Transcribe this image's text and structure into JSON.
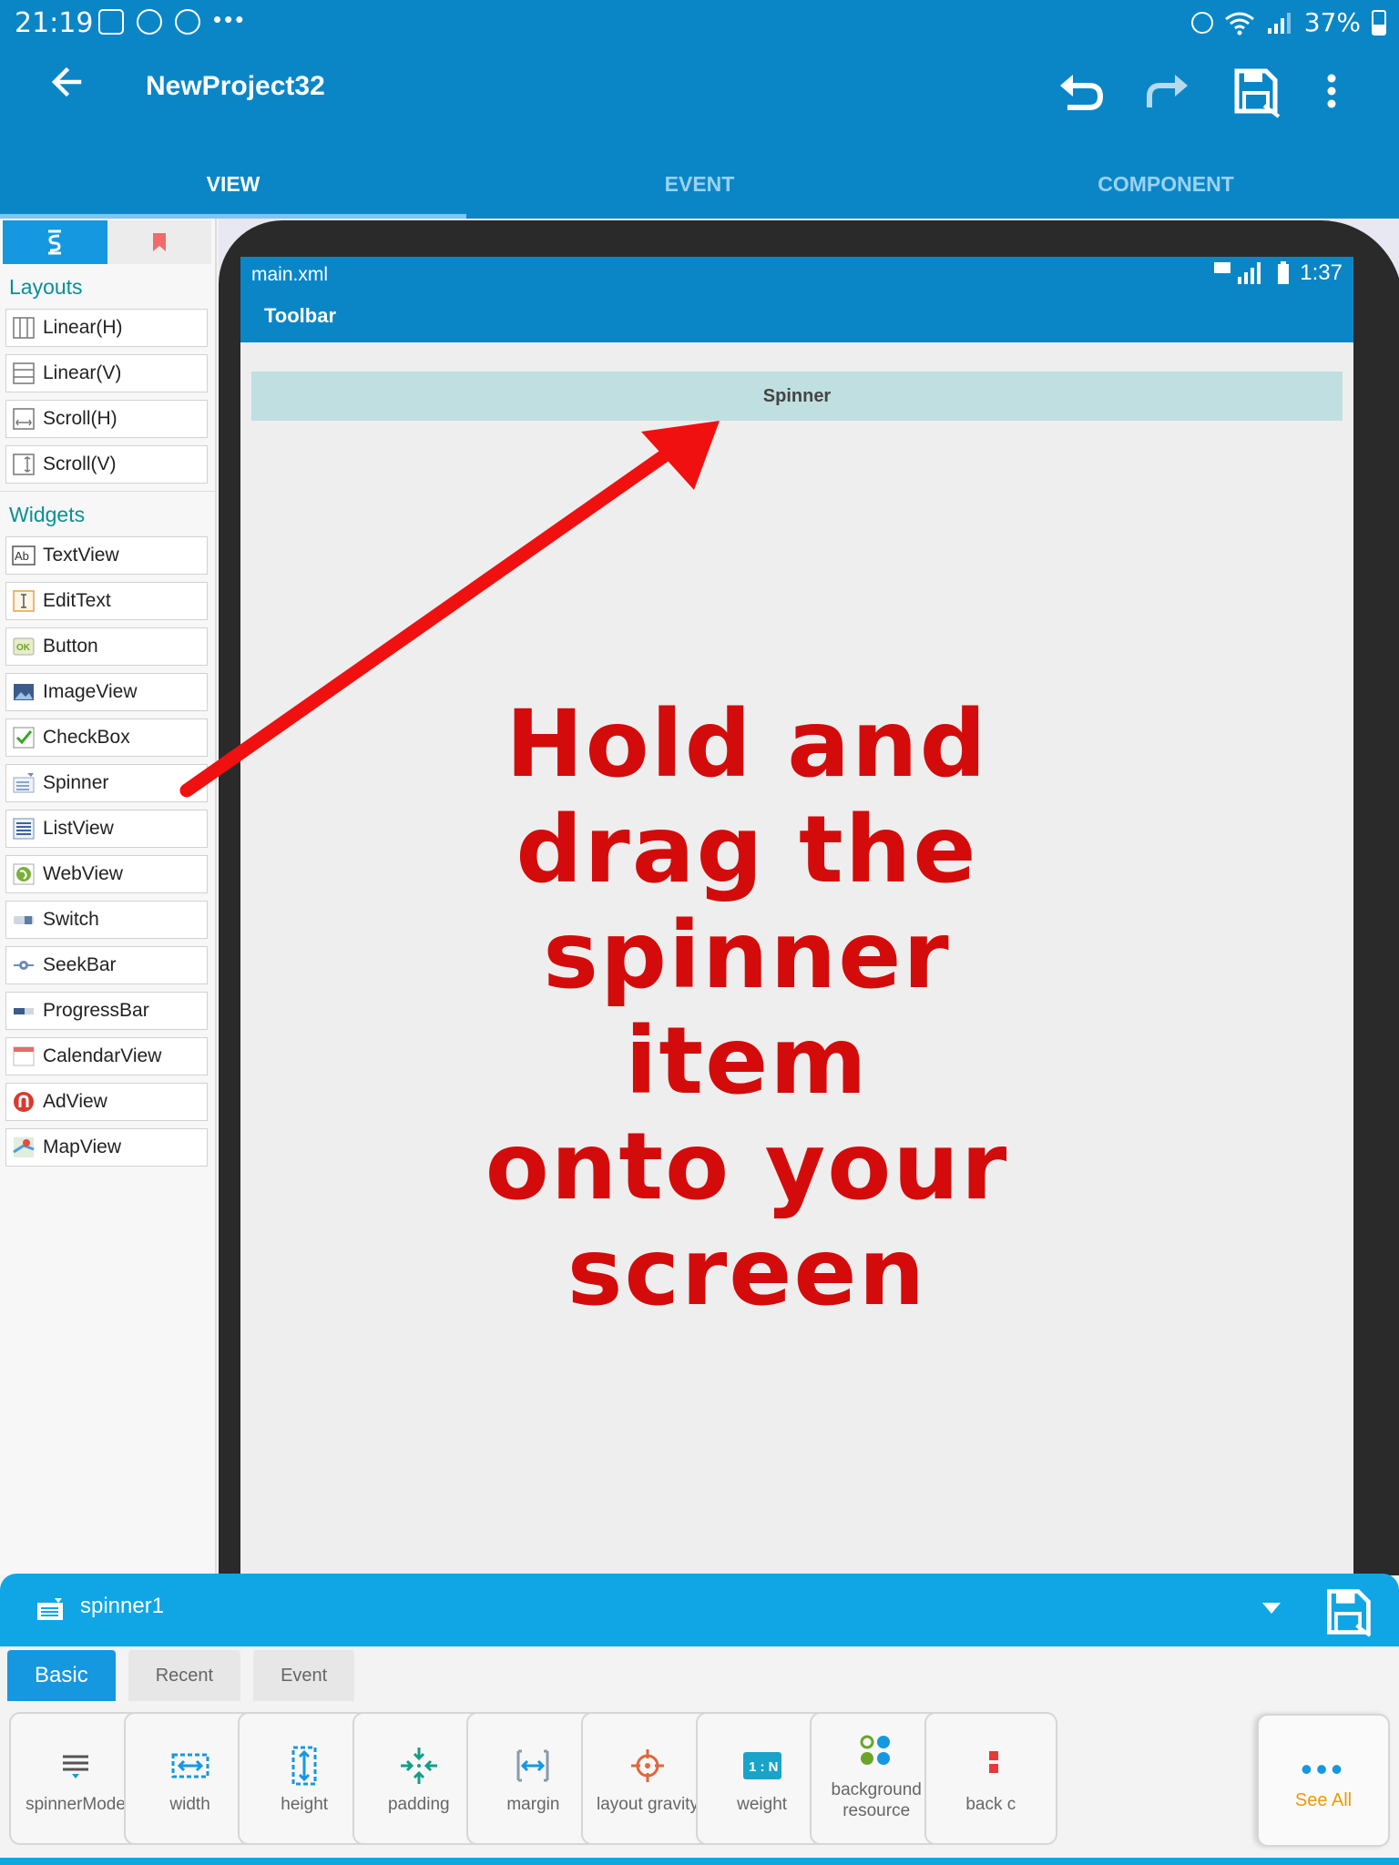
{
  "status_bar": {
    "time": "21:19",
    "battery": "37%"
  },
  "app": {
    "title": "NewProject32",
    "tabs": [
      {
        "label": "VIEW",
        "active": true
      },
      {
        "label": "EVENT",
        "active": false
      },
      {
        "label": "COMPONENT",
        "active": false
      }
    ]
  },
  "palette": {
    "layouts_title": "Layouts",
    "layouts": [
      "Linear(H)",
      "Linear(V)",
      "Scroll(H)",
      "Scroll(V)"
    ],
    "widgets_title": "Widgets",
    "widgets": [
      "TextView",
      "EditText",
      "Button",
      "ImageView",
      "CheckBox",
      "Spinner",
      "ListView",
      "WebView",
      "Switch",
      "SeekBar",
      "ProgressBar",
      "CalendarView",
      "AdView",
      "MapView"
    ]
  },
  "preview": {
    "file": "main.xml",
    "time": "1:37",
    "toolbar": "Toolbar",
    "spinner_label": "Spinner"
  },
  "overlay": {
    "lines": [
      "Hold and",
      "drag the",
      "spinner",
      "item",
      "onto your",
      "screen"
    ],
    "color": "#d40b0b"
  },
  "properties": {
    "widget_id": "spinner1",
    "tabs": [
      {
        "label": "Basic",
        "active": true
      },
      {
        "label": "Recent",
        "active": false
      },
      {
        "label": "Event",
        "active": false
      }
    ],
    "tools": [
      {
        "label": "spinnerMode",
        "icon": "spinner-mode-icon"
      },
      {
        "label": "width",
        "icon": "width-icon"
      },
      {
        "label": "height",
        "icon": "height-icon"
      },
      {
        "label": "padding",
        "icon": "padding-icon"
      },
      {
        "label": "margin",
        "icon": "margin-icon"
      },
      {
        "label": "layout gravity",
        "icon": "layout-gravity-icon"
      },
      {
        "label": "weight",
        "icon": "weight-icon",
        "badge": "1:N"
      },
      {
        "label": "background resource",
        "icon": "background-resource-icon"
      },
      {
        "label": "back c",
        "icon": "background-color-icon"
      }
    ],
    "see_all": "See All"
  },
  "colors": {
    "primary": "#0a86c7",
    "accent": "#1598e0",
    "teal": "#0a8f95",
    "see_all": "#f29900"
  }
}
